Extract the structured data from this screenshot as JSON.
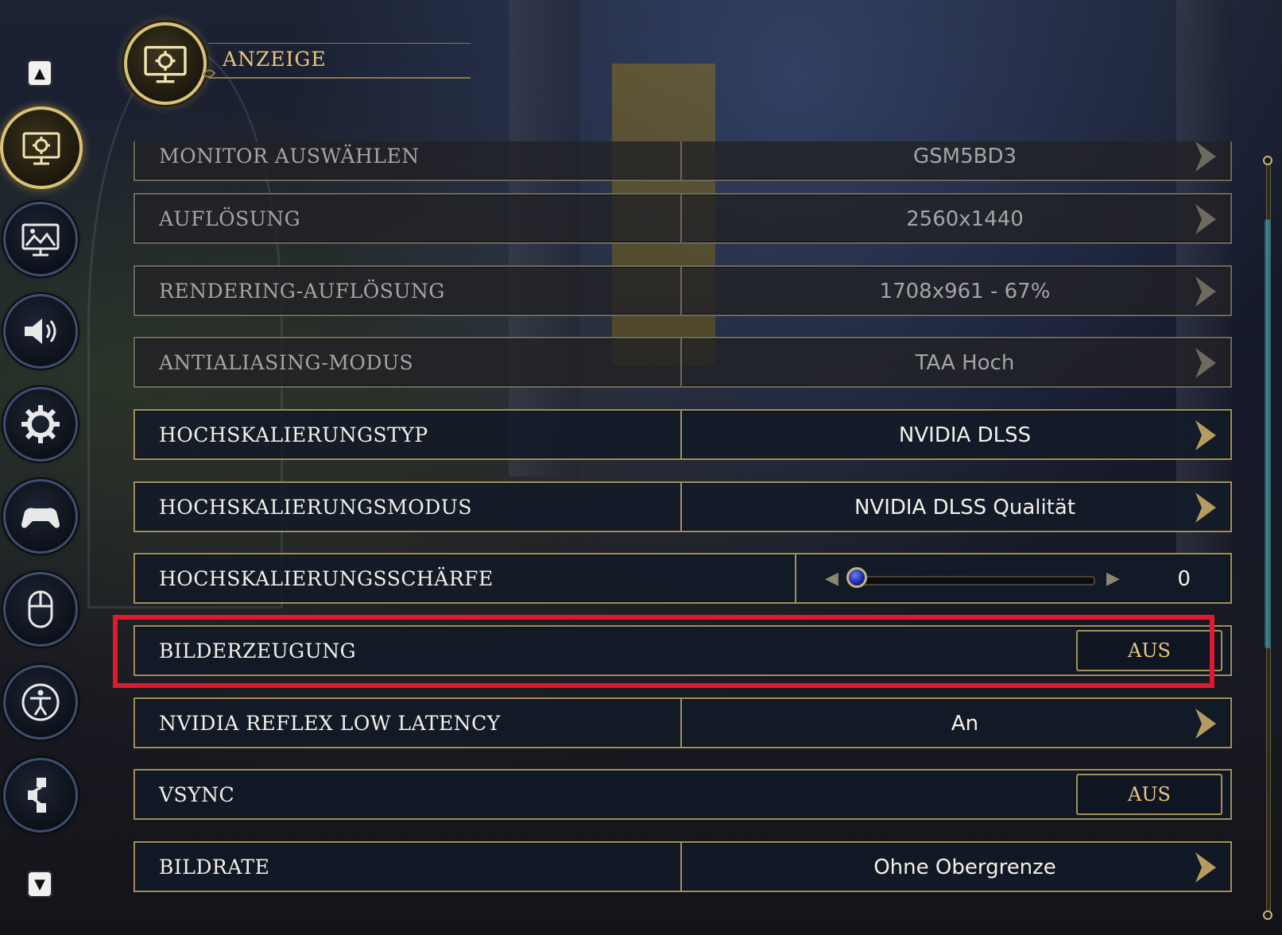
{
  "header": {
    "title": "ANZEIGE",
    "icon": "display-settings-icon"
  },
  "sidebar": {
    "items": [
      {
        "name": "display",
        "icon": "display-settings-icon",
        "active": true
      },
      {
        "name": "graphics",
        "icon": "landscape-monitor-icon",
        "active": false
      },
      {
        "name": "audio",
        "icon": "speaker-icon",
        "active": false
      },
      {
        "name": "gameplay",
        "icon": "gear-icon",
        "active": false
      },
      {
        "name": "controller",
        "icon": "gamepad-icon",
        "active": false
      },
      {
        "name": "mouse-keyboard",
        "icon": "mouse-icon",
        "active": false
      },
      {
        "name": "accessibility",
        "icon": "accessibility-icon",
        "active": false
      },
      {
        "name": "social",
        "icon": "share-network-icon",
        "active": false
      }
    ]
  },
  "settings": [
    {
      "label": "MONITOR AUSWÄHLEN",
      "value": "GSM5BD3",
      "type": "selector",
      "enabled": false
    },
    {
      "label": "AUFLÖSUNG",
      "value": "2560x1440",
      "type": "selector",
      "enabled": false
    },
    {
      "label": "RENDERING-AUFLÖSUNG",
      "value": "1708x961 - 67%",
      "type": "selector",
      "enabled": false
    },
    {
      "label": "ANTIALIASING-MODUS",
      "value": "TAA Hoch",
      "type": "selector",
      "enabled": false
    },
    {
      "label": "HOCHSKALIERUNGSTYP",
      "value": "NVIDIA DLSS",
      "type": "selector",
      "enabled": true
    },
    {
      "label": "HOCHSKALIERUNGSMODUS",
      "value": "NVIDIA DLSS Qualität",
      "type": "selector",
      "enabled": true
    },
    {
      "label": "HOCHSKALIERUNGSSCHÄRFE",
      "value": "0",
      "type": "slider",
      "slider_fraction": 0.0,
      "enabled": true
    },
    {
      "label": "BILDERZEUGUNG",
      "value": "AUS",
      "type": "toggle",
      "enabled": true,
      "highlighted": true
    },
    {
      "label": "NVIDIA REFLEX LOW LATENCY",
      "value": "An",
      "type": "selector",
      "enabled": true
    },
    {
      "label": "VSYNC",
      "value": "AUS",
      "type": "toggle",
      "enabled": true
    },
    {
      "label": "BILDRATE",
      "value": "Ohne Obergrenze",
      "type": "selector",
      "enabled": true
    }
  ],
  "colors": {
    "accent_gold": "#d8c27a",
    "highlight_red": "#e01a2e",
    "row_border": "#a48f5b"
  }
}
